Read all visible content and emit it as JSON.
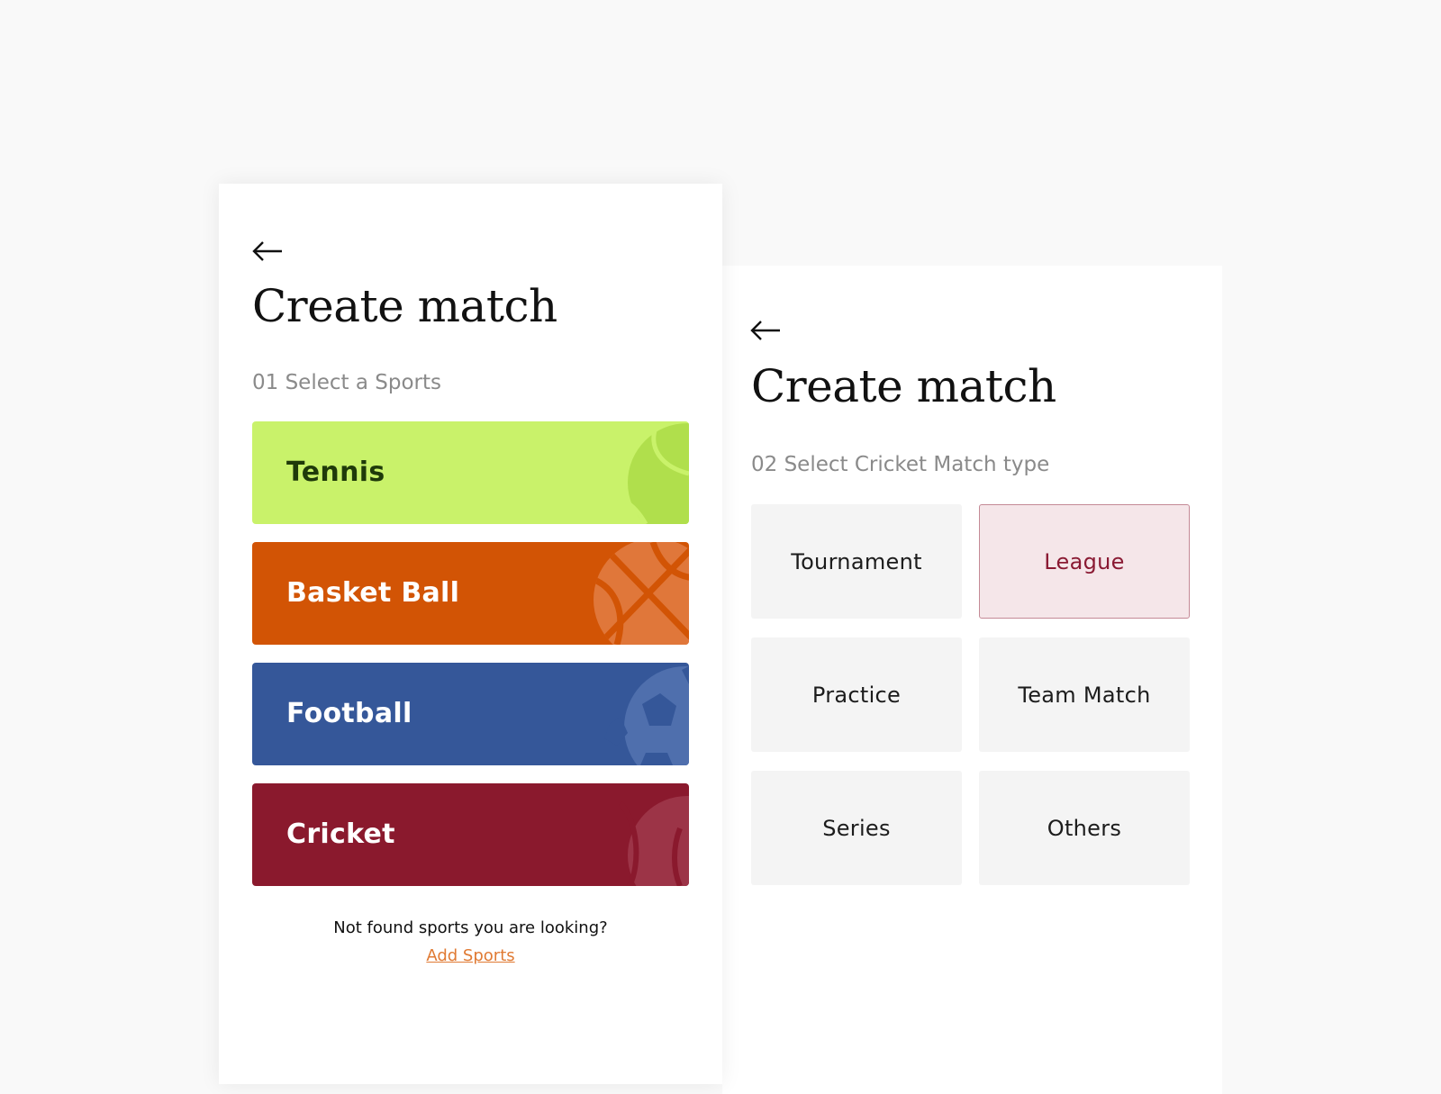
{
  "screen1": {
    "title": "Create match",
    "step_label": "01 Select a Sports",
    "sports": [
      {
        "label": "Tennis",
        "bg": "#c9f26a",
        "fg": "#1f3a0a",
        "icon": "tennis-ball-icon",
        "icon_color": "#b0df4c"
      },
      {
        "label": "Basket Ball",
        "bg": "#d25405",
        "fg": "#ffffff",
        "icon": "basketball-icon",
        "icon_color": "#e0773a"
      },
      {
        "label": "Football",
        "bg": "#355799",
        "fg": "#ffffff",
        "icon": "football-icon",
        "icon_color": "#4f6fad"
      },
      {
        "label": "Cricket",
        "bg": "#8a192d",
        "fg": "#ffffff",
        "icon": "cricket-ball-icon",
        "icon_color": "#9c3447"
      }
    ],
    "not_found_text": "Not found sports you are looking?",
    "add_sports_link": "Add Sports"
  },
  "screen2": {
    "title": "Create match",
    "step_label": "02 Select Cricket Match type",
    "match_types": [
      {
        "label": "Tournament",
        "selected": false
      },
      {
        "label": "League",
        "selected": true
      },
      {
        "label": "Practice",
        "selected": false
      },
      {
        "label": "Team Match",
        "selected": false
      },
      {
        "label": "Series",
        "selected": false
      },
      {
        "label": "Others",
        "selected": false
      }
    ]
  },
  "colors": {
    "page_bg": "#f9f9f9",
    "tile_bg": "#f4f4f4",
    "selected_bg": "#f5e6e9",
    "selected_border": "#c48a96",
    "selected_text": "#8a1a33",
    "link": "#e07a33"
  }
}
